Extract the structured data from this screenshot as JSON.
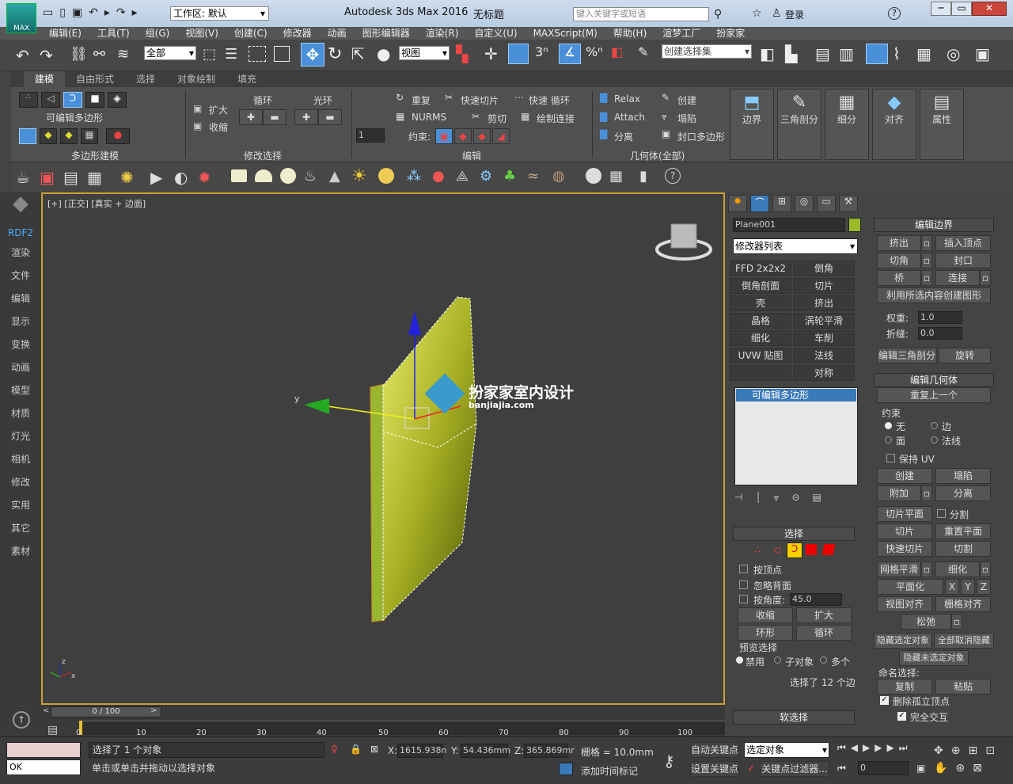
{
  "titlebar": {
    "app_title": "Autodesk 3ds Max 2016",
    "doc_title": "无标题",
    "workspace": "工作区: 默认",
    "search_placeholder": "键入关键字或短语",
    "login": "登录",
    "logo": "MAX"
  },
  "menu": [
    "编辑(E)",
    "工具(T)",
    "组(G)",
    "视图(V)",
    "创建(C)",
    "修改器",
    "动画",
    "图形编辑器",
    "渲染(R)",
    "自定义(U)",
    "MAXScript(M)",
    "帮助(H)",
    "渲梦工厂",
    "扮家家"
  ],
  "toolbar": {
    "selection_filter": "全部",
    "ref_coord": "视图",
    "named_sel": "创建选择集",
    "angle_snap": "3",
    "pct_snap": "%"
  },
  "ribbon": {
    "tabs": [
      "建模",
      "自由形式",
      "选择",
      "对象绘制",
      "填充"
    ],
    "group_poly": "多边形建模",
    "editable_poly": "可编辑多边形",
    "grow": "扩大",
    "shrink": "收缩",
    "loop": "循环",
    "ring": "光环",
    "group_modsel": "修改选择",
    "repeat": "重复",
    "quickslice": "快速切片",
    "quickloop": "快速 循环",
    "nurms": "NURMS",
    "cut": "剪切",
    "paintconnect": "绘制连接",
    "constraint": "约束:",
    "group_edit": "编辑",
    "spinner_val": "1",
    "relax": "Relax",
    "create": "创建",
    "attach": "Attach",
    "collapse": "塌陷",
    "detach": "分离",
    "cap": "封口多边形",
    "group_geom": "几何体(全部)",
    "big": [
      "边界",
      "三角剖分",
      "细分",
      "对齐",
      "属性"
    ]
  },
  "leftdock": [
    "RDF2",
    "渲染",
    "文件",
    "编辑",
    "显示",
    "变换",
    "动画",
    "模型",
    "材质",
    "灯光",
    "相机",
    "修改",
    "实用",
    "其它",
    "素材"
  ],
  "viewport": {
    "label": "[+] [正交] [真实 + 边面]",
    "watermark": "扮家家室内设计",
    "watermark_url": "banjiajia.com",
    "axis_y": "y",
    "axis_z": "z",
    "axis_x": "x"
  },
  "timeline": {
    "frame": "0 / 100",
    "ticks": [
      "10",
      "20",
      "30",
      "40",
      "50",
      "60",
      "70",
      "80",
      "90",
      "100"
    ],
    "zero": "0"
  },
  "command": {
    "object_name": "Plane001",
    "modlist": "修改器列表",
    "mods": [
      "FFD 2x2x2",
      "倒角",
      "倒角剖面",
      "切片",
      "壳",
      "挤出",
      "晶格",
      "涡轮平滑",
      "细化",
      "车削",
      "UVW 贴图",
      "法线",
      "",
      "对称"
    ],
    "stack_item": "可编辑多边形",
    "sel_title": "选择",
    "by_vertex": "按顶点",
    "ignore_back": "忽略背面",
    "by_angle": "按角度:",
    "angle_val": "45.0",
    "shrink": "收缩",
    "grow": "扩大",
    "ring": "环形",
    "loop": "循环",
    "preview": "预览选择",
    "disable": "禁用",
    "subobj": "子对象",
    "multi": "多个",
    "selected_info": "选择了 12 个边",
    "soft_sel": "软选择"
  },
  "rollout": {
    "edit_edges": "编辑边界",
    "extrude": "挤出",
    "insert_vertex": "插入顶点",
    "chamfer": "切角",
    "cap": "封口",
    "bridge": "桥",
    "connect": "连接",
    "create_shape": "利用所选内容创建图形",
    "weight": "权重:",
    "weight_val": "1.0",
    "crease": "折缝:",
    "crease_val": "0.0",
    "edit_tri": "编辑三角剖分",
    "turn": "旋转",
    "edit_geom": "编辑几何体",
    "repeat_last": "重复上一个",
    "constraints": "约束",
    "c_none": "无",
    "c_edge": "边",
    "c_face": "面",
    "c_normal": "法线",
    "preserve_uv": "保持 UV",
    "create": "创建",
    "collapse": "塌陷",
    "attach": "附加",
    "detach": "分离",
    "slice_plane": "切片平面",
    "split": "分割",
    "slice": "切片",
    "reset_plane": "重置平面",
    "quickslice": "快速切片",
    "cut": "切割",
    "meshsmooth": "网格平滑",
    "tessellate": "细化",
    "make_planar": "平面化",
    "x": "X",
    "y": "Y",
    "z": "Z",
    "view_align": "视图对齐",
    "grid_align": "栅格对齐",
    "relax": "松弛",
    "hide_sel": "隐藏选定对象",
    "unhide_all": "全部取消隐藏",
    "hide_unsel": "隐藏未选定对象",
    "named_sel": "命名选择:",
    "copy": "复制",
    "paste": "粘贴",
    "del_iso": "删除孤立顶点",
    "full_interact": "完全交互"
  },
  "status": {
    "script_out": "OK",
    "sel_count": "选择了 1 个对象",
    "prompt": "单击或单击并拖动以选择对象",
    "x_label": "X:",
    "x_val": "1615.938n",
    "y_label": "Y:",
    "y_val": "54.436mm",
    "z_label": "Z:",
    "z_val": "365.869mr",
    "grid": "栅格 = 10.0mm",
    "add_time_tag": "添加时间标记",
    "auto_key": "自动关键点",
    "set_key": "设置关键点",
    "sel_obj": "选定对象",
    "key_filter": "关键点过滤器...",
    "frame_val": "0"
  },
  "colors": {
    "accent": "#c8a033",
    "object": "#b8c034",
    "selection_blue": "#1e90ff"
  }
}
